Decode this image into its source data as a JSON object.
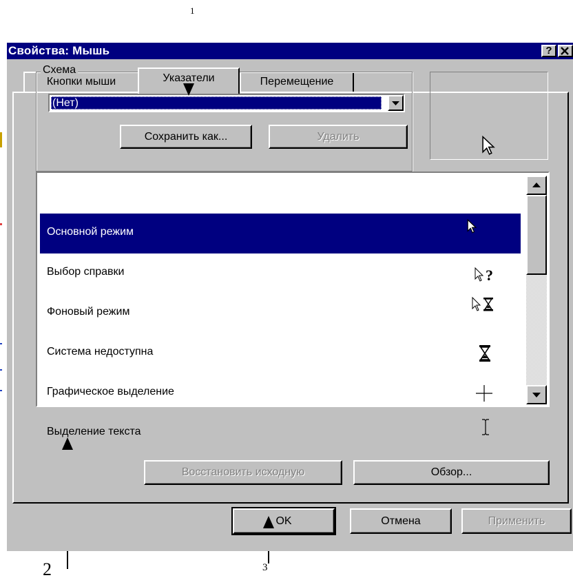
{
  "annotations": {
    "callout_1": "1",
    "callout_2": "2",
    "callout_3": "3"
  },
  "window": {
    "title": "Свойства: Мышь",
    "help_button": "?",
    "close_button": "×"
  },
  "tabs": [
    {
      "label": "Кнопки мыши",
      "selected": false
    },
    {
      "label": "Указатели",
      "selected": true
    },
    {
      "label": "Перемещение",
      "selected": false
    }
  ],
  "schema": {
    "group_label": "Схема",
    "selected_value": "(Нет)",
    "save_as_label": "Сохранить как...",
    "delete_label": "Удалить"
  },
  "preview": {
    "icon": "arrow-cursor-icon"
  },
  "cursor_list": {
    "items": [
      {
        "label": "Основной режим",
        "icon": "arrow-cursor-icon",
        "selected": true
      },
      {
        "label": "Выбор справки",
        "icon": "help-select-cursor-icon",
        "selected": false
      },
      {
        "label": "Фоновый режим",
        "icon": "working-in-background-cursor-icon",
        "selected": false
      },
      {
        "label": "Система недоступна",
        "icon": "hourglass-cursor-icon",
        "selected": false
      },
      {
        "label": "Графическое выделение",
        "icon": "crosshair-cursor-icon",
        "selected": false
      },
      {
        "label": "Выделение текста",
        "icon": "text-select-cursor-icon",
        "selected": false
      }
    ]
  },
  "list_buttons": {
    "restore_default_label": "Восстановить исходную",
    "browse_label": "Обзор..."
  },
  "footer": {
    "ok_label": "OK",
    "cancel_label": "Отмена",
    "apply_label": "Применить"
  },
  "colors": {
    "titlebar": "#000080",
    "face": "#c0c0c0",
    "selection": "#000080"
  }
}
